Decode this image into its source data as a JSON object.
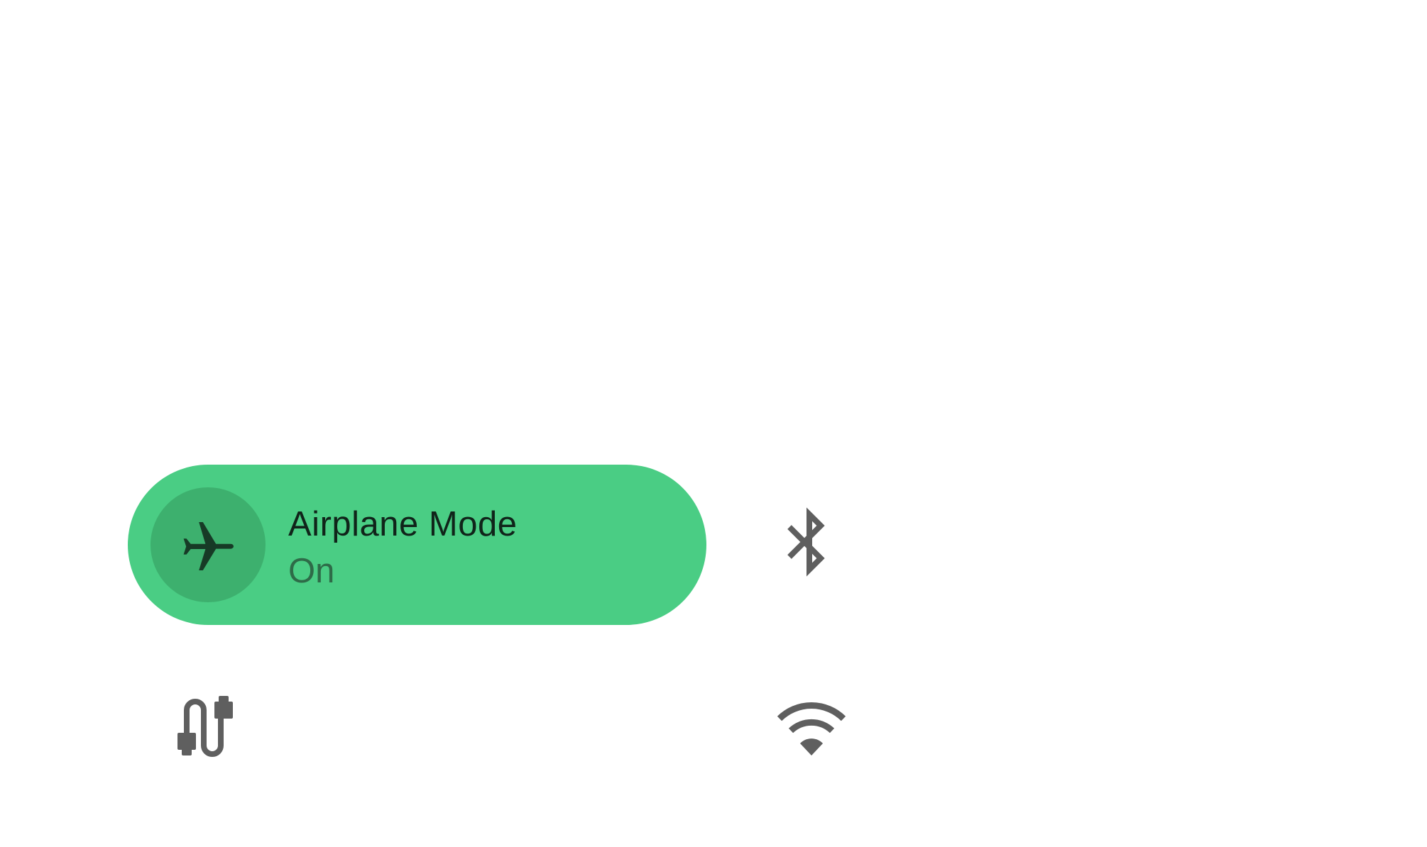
{
  "quick_settings": {
    "airplane": {
      "title": "Airplane Mode",
      "state": "On",
      "icon": "airplane-icon",
      "active_color": "#4ACD84",
      "icon_bg_color": "#3DB06E",
      "icon_color": "#173A26"
    },
    "bluetooth": {
      "icon": "bluetooth-icon",
      "color": "#5F5F5F"
    },
    "usb": {
      "icon": "usb-cable-icon",
      "color": "#5F5F5F"
    },
    "wifi": {
      "icon": "wifi-icon",
      "color": "#5F5F5F"
    }
  }
}
